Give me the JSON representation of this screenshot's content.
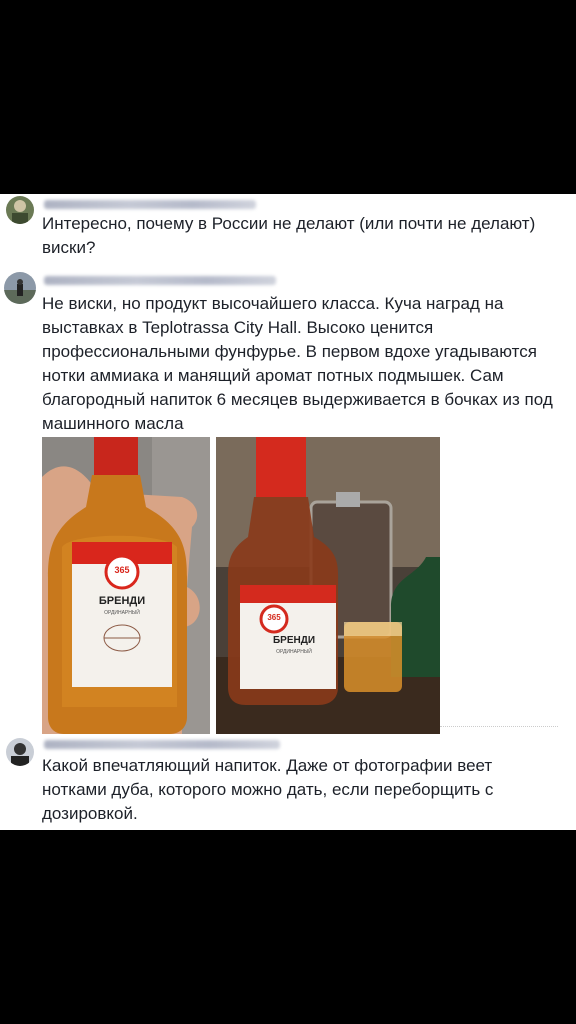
{
  "comments": [
    {
      "text": "Интересно, почему в России не делают (или почти не делают) виски?"
    },
    {
      "text": "Не виски, но продукт высочайшего класса. Куча наград на выставках в Teplotrassa City Hall. Высоко ценится профессиональными фунфурье. В первом вдохе угадываются нотки аммиака и манящий аромат потных подмышек. Сам благородный напиток 6 месяцев выдерживается в бочках из под машинного масла"
    },
    {
      "text": "Какой впечатляющий напиток. Даже от фотографии веет нотками дуба, которого можно дать, если переборщить с дозировкой."
    }
  ],
  "label": {
    "brand_number": "365",
    "product": "БРЕНДИ",
    "subtitle": "ОРДИНАРНЫЙ"
  }
}
